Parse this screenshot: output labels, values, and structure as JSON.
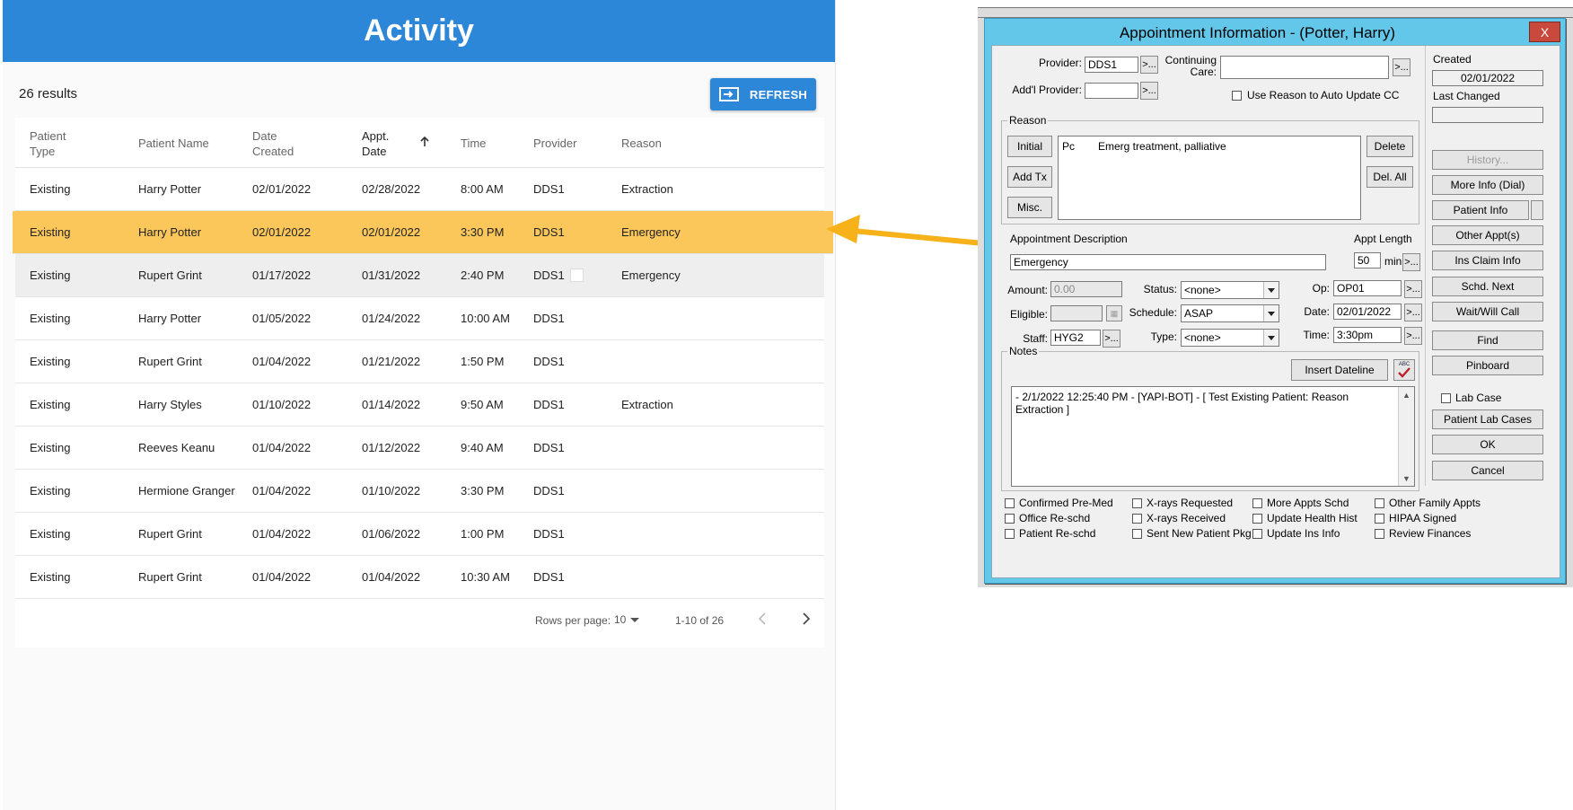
{
  "activity": {
    "title": "Activity",
    "results_count": "26 results",
    "refresh_label": "REFRESH",
    "columns": [
      "Patient\nType",
      "Patient Name",
      "Date\nCreated",
      "Appt.\nDate",
      "Time",
      "Provider",
      "Reason"
    ],
    "rows": [
      [
        "Existing",
        "Harry Potter",
        "02/01/2022",
        "02/28/2022",
        "8:00 AM",
        "DDS1",
        "Extraction"
      ],
      [
        "Existing",
        "Harry Potter",
        "02/01/2022",
        "02/01/2022",
        "3:30 PM",
        "DDS1",
        "Emergency"
      ],
      [
        "Existing",
        "Rupert Grint",
        "01/17/2022",
        "01/31/2022",
        "2:40 PM",
        "DDS1",
        "Emergency"
      ],
      [
        "Existing",
        "Harry Potter",
        "01/05/2022",
        "01/24/2022",
        "10:00 AM",
        "DDS1",
        ""
      ],
      [
        "Existing",
        "Rupert Grint",
        "01/04/2022",
        "01/21/2022",
        "1:50 PM",
        "DDS1",
        ""
      ],
      [
        "Existing",
        "Harry Styles",
        "01/10/2022",
        "01/14/2022",
        "9:50 AM",
        "DDS1",
        "Extraction"
      ],
      [
        "Existing",
        "Reeves Keanu",
        "01/04/2022",
        "01/12/2022",
        "9:40 AM",
        "DDS1",
        ""
      ],
      [
        "Existing",
        "Hermione Granger",
        "01/04/2022",
        "01/10/2022",
        "3:30 PM",
        "DDS1",
        ""
      ],
      [
        "Existing",
        "Rupert Grint",
        "01/04/2022",
        "01/06/2022",
        "1:00 PM",
        "DDS1",
        ""
      ],
      [
        "Existing",
        "Rupert Grint",
        "01/04/2022",
        "01/04/2022",
        "10:30 AM",
        "DDS1",
        ""
      ]
    ],
    "pagination": {
      "rows_per_page_label": "Rows per page:",
      "rows_per_page": "10",
      "range": "1-10 of 26"
    },
    "colors": {
      "header": "#2d87d9",
      "highlight": "#fbc75b",
      "arrow": "#f7b219"
    }
  },
  "dialog": {
    "title": "Appointment Information - (Potter, Harry)",
    "close": "X",
    "provider_label": "Provider:",
    "provider_value": "DDS1",
    "ellipsis": ">...",
    "continuing_care_label": "Continuing\nCare:",
    "continuing_care_value": "",
    "addl_provider_label": "Add'l Provider:",
    "addl_provider_value": "",
    "use_reason_label": "Use Reason to Auto Update CC",
    "reason_group": "Reason",
    "reason_buttons": {
      "initial": "Initial",
      "add_tx": "Add Tx",
      "misc": "Misc.",
      "delete": "Delete",
      "del_all": "Del. All"
    },
    "reason_code": "Pc",
    "reason_text": "Emerg treatment, palliative",
    "appt_desc_label": "Appointment Description",
    "appt_desc_value": "Emergency",
    "appt_length_label": "Appt Length",
    "appt_length_value": "50",
    "appt_length_unit": "min",
    "amount_label": "Amount:",
    "amount_value": "0.00",
    "status_label": "Status:",
    "status_value": "<none>",
    "op_label": "Op:",
    "op_value": "OP01",
    "eligible_label": "Eligible:",
    "schedule_label": "Schedule:",
    "schedule_value": "ASAP",
    "date_label": "Date:",
    "date_value": "02/01/2022",
    "staff_label": "Staff:",
    "staff_value": "HYG2",
    "type_label": "Type:",
    "type_value": "<none>",
    "time_label": "Time:",
    "time_value": "3:30pm",
    "notes_group": "Notes",
    "insert_dateline": "Insert Dateline",
    "spell_label": "ABC",
    "notes_text": "- 2/1/2022 12:25:40 PM - [YAPI-BOT] - [ Test Existing Patient: Reason\nExtraction ]",
    "created_label": "Created",
    "created_value": "02/01/2022",
    "last_changed_label": "Last Changed",
    "last_changed_value": "",
    "side_buttons": [
      "History...",
      "More Info (Dial)",
      "Patient Info",
      "Other Appt(s)",
      "Ins Claim Info",
      "Schd. Next",
      "Wait/Will Call",
      "Find",
      "Pinboard"
    ],
    "lab_case_label": "Lab Case",
    "patient_lab_cases": "Patient Lab Cases",
    "ok": "OK",
    "cancel": "Cancel",
    "checkboxes": [
      [
        "Confirmed Pre-Med",
        "X-rays Requested",
        "More Appts Schd",
        "Other Family Appts"
      ],
      [
        "Office Re-schd",
        "X-rays Received",
        "Update Health Hist",
        "HIPAA Signed"
      ],
      [
        "Patient Re-schd",
        "Sent New Patient Pkg",
        "Update Ins Info",
        "Review Finances"
      ]
    ],
    "colors": {
      "frame": "#63c7ea",
      "close": "#c94a3d"
    }
  }
}
